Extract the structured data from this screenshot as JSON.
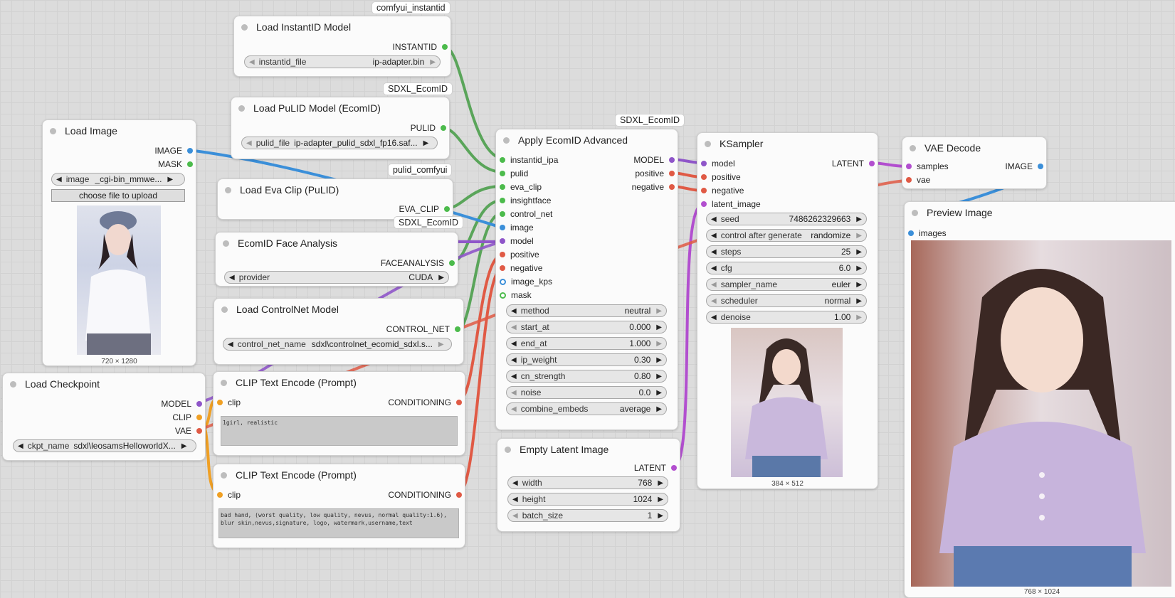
{
  "colors": {
    "image": "#3b8fd9",
    "mask": "#4cbb4c",
    "instantid": "#4cbb4c",
    "pulid": "#4cbb4c",
    "eva_clip": "#4cbb4c",
    "faceanalysis": "#4cbb4c",
    "control_net": "#4cbb4c",
    "model": "#8f56c9",
    "clip": "#f0a024",
    "vae": "#e05a45",
    "conditioning": "#e05a45",
    "latent": "#b24fcf"
  },
  "tags": {
    "instantid": "comfyui_instantid",
    "pulid": "SDXL_EcomID",
    "apply": "SDXL_EcomID",
    "eva": "pulid_comfyui",
    "face": "SDXL_EcomID"
  },
  "load_instantid": {
    "title": "Load InstantID Model",
    "out": "INSTANTID",
    "w_label": "instantid_file",
    "w_value": "ip-adapter.bin"
  },
  "load_pulid": {
    "title": "Load PuLID Model (EcomID)",
    "out": "PULID",
    "w_label": "pulid_file",
    "w_value": "ip-adapter_pulid_sdxl_fp16.saf..."
  },
  "load_image": {
    "title": "Load Image",
    "out_image": "IMAGE",
    "out_mask": "MASK",
    "w_label": "image",
    "w_value": "_cgi-bin_mmwe...",
    "upload": "choose file to upload",
    "dims": "720 × 1280"
  },
  "load_eva": {
    "title": "Load Eva Clip (PuLID)",
    "out": "EVA_CLIP"
  },
  "face_analysis": {
    "title": "EcomID Face Analysis",
    "out": "FACEANALYSIS",
    "w_label": "provider",
    "w_value": "CUDA"
  },
  "controlnet": {
    "title": "Load ControlNet Model",
    "out": "CONTROL_NET",
    "w_label": "control_net_name",
    "w_value": "sdxl\\controlnet_ecomid_sdxl.s..."
  },
  "checkpoint": {
    "title": "Load Checkpoint",
    "out_model": "MODEL",
    "out_clip": "CLIP",
    "out_vae": "VAE",
    "w_label": "ckpt_name",
    "w_value": "sdxl\\leosamsHelloworldX..."
  },
  "clip_pos": {
    "title": "CLIP Text Encode (Prompt)",
    "in": "clip",
    "out": "CONDITIONING",
    "text": "1girl, realistic"
  },
  "clip_neg": {
    "title": "CLIP Text Encode (Prompt)",
    "in": "clip",
    "out": "CONDITIONING",
    "text": "bad hand, (worst quality, low quality, nevus, normal quality:1.6),\nblur skin,nevus,signature, logo, watermark,username,text"
  },
  "apply": {
    "title": "Apply EcomID Advanced",
    "inputs": [
      "instantid_ipa",
      "pulid",
      "eva_clip",
      "insightface",
      "control_net",
      "image",
      "model",
      "positive",
      "negative",
      "image_kps",
      "mask"
    ],
    "outputs": [
      "MODEL",
      "positive",
      "negative"
    ],
    "widgets": [
      {
        "label": "method",
        "value": "neutral"
      },
      {
        "label": "start_at",
        "value": "0.000"
      },
      {
        "label": "end_at",
        "value": "1.000"
      },
      {
        "label": "ip_weight",
        "value": "0.30"
      },
      {
        "label": "cn_strength",
        "value": "0.80"
      },
      {
        "label": "noise",
        "value": "0.0"
      },
      {
        "label": "combine_embeds",
        "value": "average"
      }
    ]
  },
  "empty_latent": {
    "title": "Empty Latent Image",
    "out": "LATENT",
    "widgets": [
      {
        "label": "width",
        "value": "768"
      },
      {
        "label": "height",
        "value": "1024"
      },
      {
        "label": "batch_size",
        "value": "1"
      }
    ]
  },
  "ksampler": {
    "title": "KSampler",
    "inputs": [
      "model",
      "positive",
      "negative",
      "latent_image"
    ],
    "out": "LATENT",
    "widgets": [
      {
        "label": "seed",
        "value": "7486262329663"
      },
      {
        "label": "control after generate",
        "value": "randomize"
      },
      {
        "label": "steps",
        "value": "25"
      },
      {
        "label": "cfg",
        "value": "6.0"
      },
      {
        "label": "sampler_name",
        "value": "euler"
      },
      {
        "label": "scheduler",
        "value": "normal"
      },
      {
        "label": "denoise",
        "value": "1.00"
      }
    ],
    "dims": "384 × 512"
  },
  "vae_decode": {
    "title": "VAE Decode",
    "in_samples": "samples",
    "in_vae": "vae",
    "out": "IMAGE"
  },
  "preview": {
    "title": "Preview Image",
    "in": "images",
    "dims": "768 × 1024"
  }
}
